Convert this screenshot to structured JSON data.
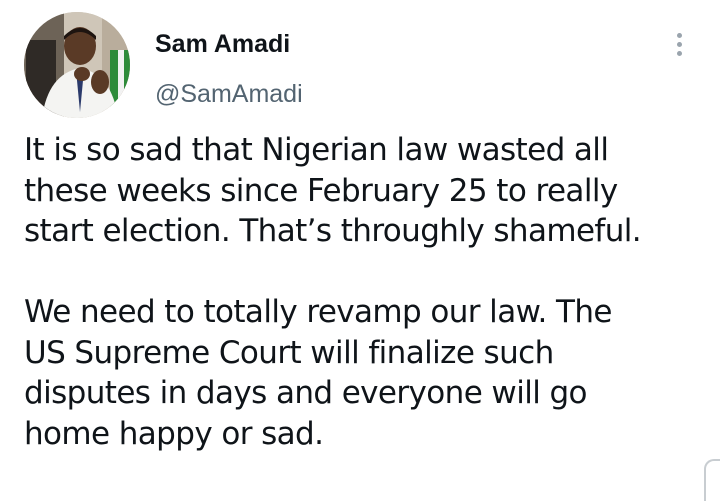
{
  "tweet": {
    "author": {
      "display_name": "Sam Amadi",
      "handle": "@SamAmadi",
      "avatar_icon": "profile-photo"
    },
    "more_icon": "more-vertical-icon",
    "text": {
      "paragraph_1": "It is so sad that Nigerian law wasted all\nthese weeks since February 25 to really\nstart election. That’s throughly shameful.",
      "paragraph_2": "We need to totally revamp our law. The\nUS Supreme Court will finalize such\ndisputes in days and everyone will go\nhome happy or sad."
    }
  },
  "colors": {
    "text_primary": "#0f1419",
    "text_secondary": "#536471",
    "background": "#ffffff"
  }
}
